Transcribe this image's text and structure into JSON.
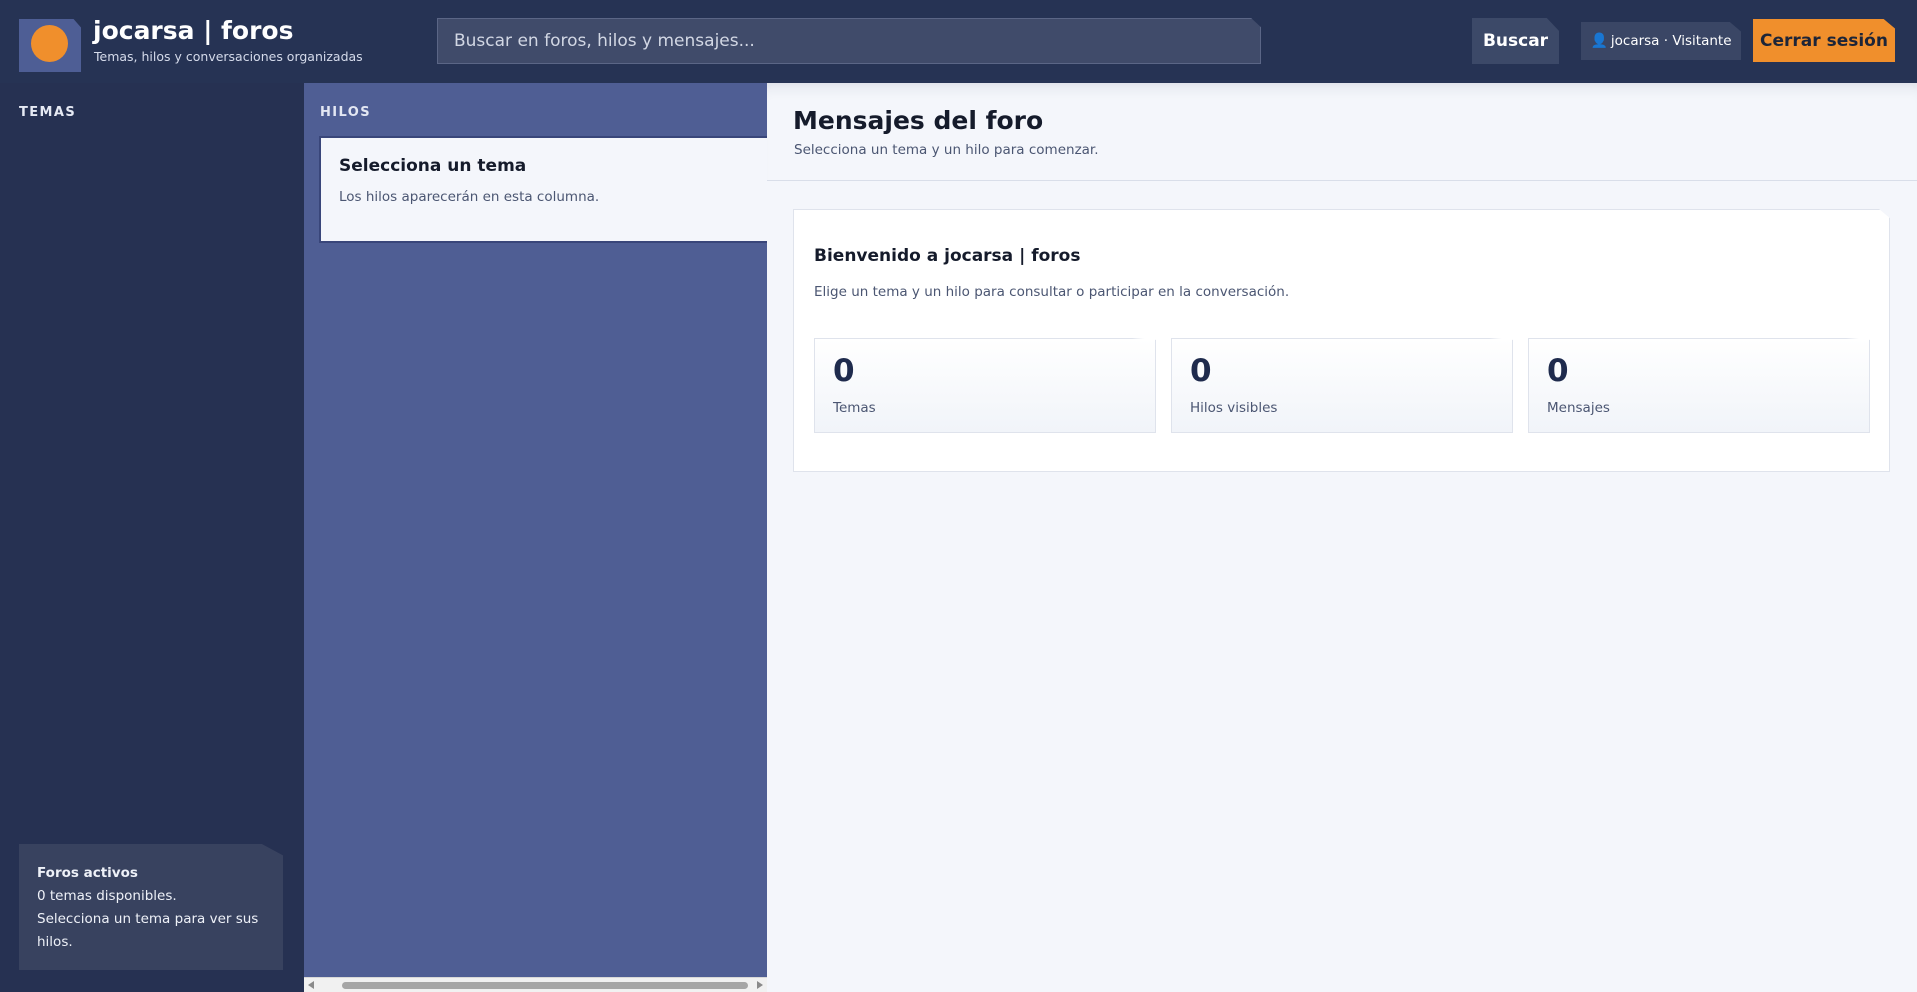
{
  "header": {
    "brand_title": "jocarsa | foros",
    "brand_subtitle": "Temas, hilos y conversaciones organizadas",
    "search_placeholder": "Buscar en foros, hilos y mensajes...",
    "search_button": "Buscar",
    "user_icon": "user-icon",
    "user_label": "jocarsa · Visitante",
    "logout_button": "Cerrar sesión"
  },
  "sidebar": {
    "heading": "TEMAS",
    "card": {
      "title": "Foros activos",
      "line1": "0 temas disponibles.",
      "line2": "Selecciona un tema para ver sus hilos."
    }
  },
  "threads": {
    "heading": "HILOS",
    "placeholder_title": "Selecciona un tema",
    "placeholder_desc": "Los hilos aparecerán en esta columna."
  },
  "main": {
    "title": "Mensajes del foro",
    "subtitle": "Selecciona un tema y un hilo para comenzar.",
    "welcome": {
      "title": "Bienvenido a jocarsa | foros",
      "description": "Elige un tema y un hilo para consultar o participar en la conversación.",
      "stats": [
        {
          "value": "0",
          "label": "Temas"
        },
        {
          "value": "0",
          "label": "Hilos visibles"
        },
        {
          "value": "0",
          "label": "Mensajes"
        }
      ]
    }
  },
  "colors": {
    "header_bg": "#263354",
    "sidebar_bg": "#263152",
    "threads_bg": "#4f5e94",
    "accent_orange": "#f08f2c",
    "main_bg": "#f4f6fb"
  }
}
